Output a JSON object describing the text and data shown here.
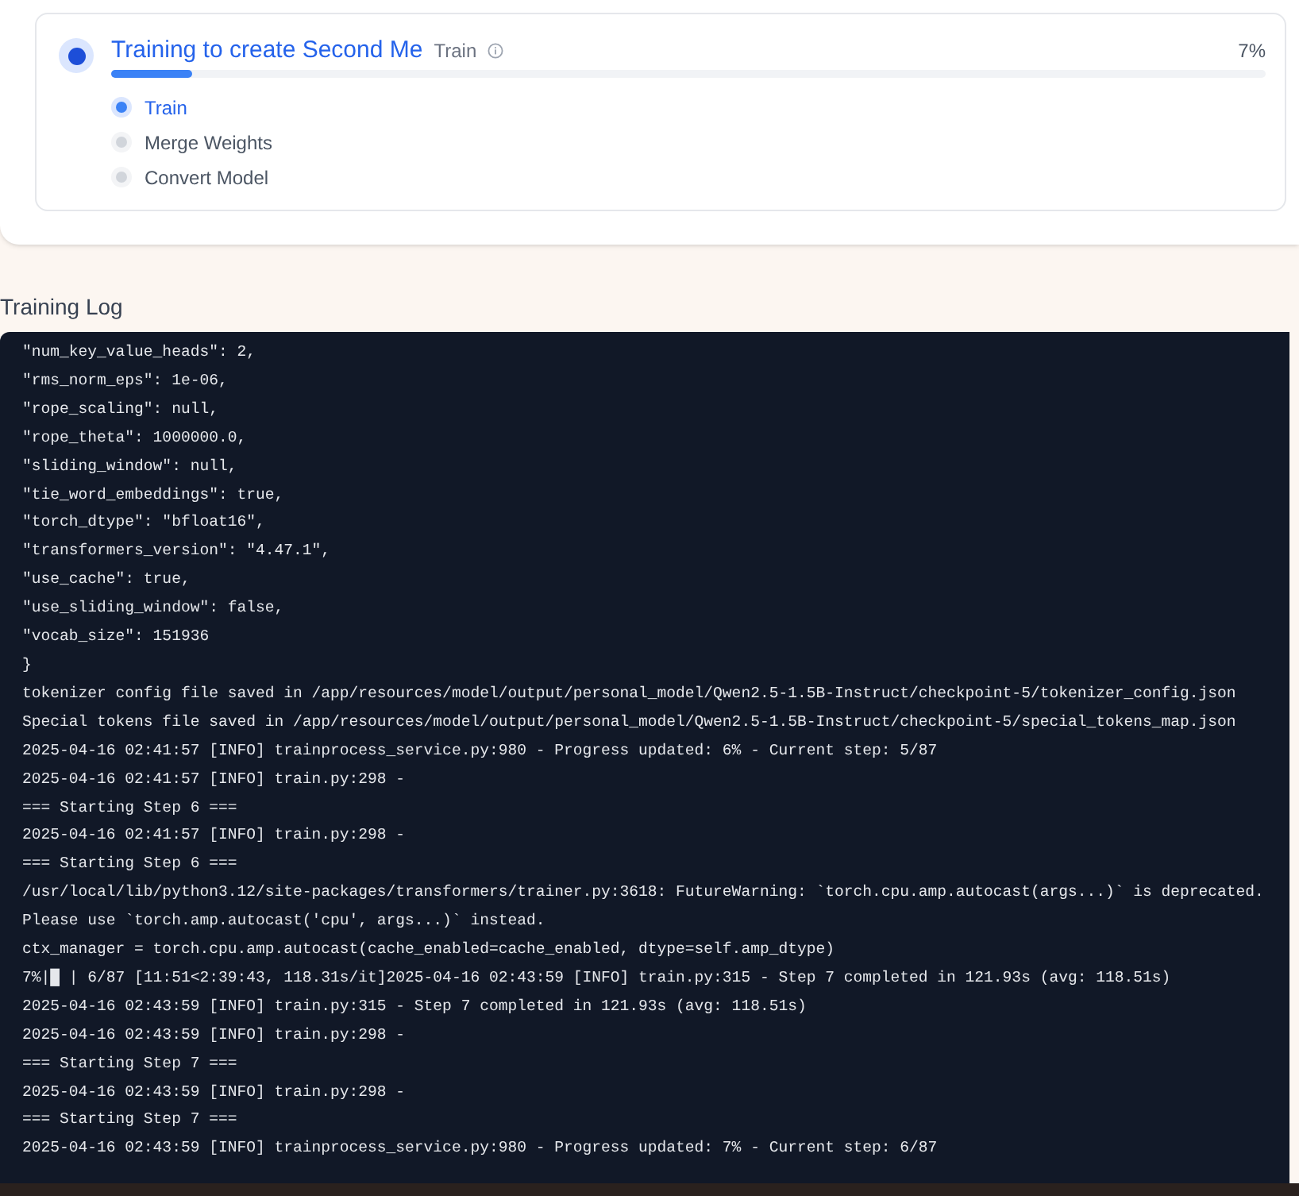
{
  "stage": {
    "title": "Training to create Second Me",
    "tag": "Train",
    "percent": "7%",
    "level": 0.07,
    "steps": [
      {
        "label": "Train",
        "selected": true
      },
      {
        "label": "Merge Weights",
        "selected": false
      },
      {
        "label": "Convert Model",
        "selected": false
      }
    ]
  },
  "log": {
    "title": "Training Log",
    "lines": [
      "\"num_key_value_heads\": 2,",
      "\"rms_norm_eps\": 1e-06,",
      "\"rope_scaling\": null,",
      "\"rope_theta\": 1000000.0,",
      "\"sliding_window\": null,",
      "\"tie_word_embeddings\": true,",
      "\"torch_dtype\": \"bfloat16\",",
      "\"transformers_version\": \"4.47.1\",",
      "\"use_cache\": true,",
      "\"use_sliding_window\": false,",
      "\"vocab_size\": 151936",
      "}",
      "tokenizer config file saved in /app/resources/model/output/personal_model/Qwen2.5-1.5B-Instruct/checkpoint-5/tokenizer_config.json",
      "Special tokens file saved in /app/resources/model/output/personal_model/Qwen2.5-1.5B-Instruct/checkpoint-5/special_tokens_map.json",
      "2025-04-16 02:41:57 [INFO] trainprocess_service.py:980 - Progress updated: 6% - Current step: 5/87",
      "2025-04-16 02:41:57 [INFO] train.py:298 -",
      "=== Starting Step 6 ===",
      "2025-04-16 02:41:57 [INFO] train.py:298 -",
      "=== Starting Step 6 ===",
      "/usr/local/lib/python3.12/site-packages/transformers/trainer.py:3618: FutureWarning: `torch.cpu.amp.autocast(args...)` is deprecated.",
      "Please use `torch.amp.autocast('cpu', args...)` instead.",
      "ctx_manager = torch.cpu.amp.autocast(cache_enabled=cache_enabled, dtype=self.amp_dtype)",
      "7%|█ | 6/87 [11:51<2:39:43, 118.31s/it]2025-04-16 02:43:59 [INFO] train.py:315 - Step 7 completed in 121.93s (avg: 118.51s)",
      "2025-04-16 02:43:59 [INFO] train.py:315 - Step 7 completed in 121.93s (avg: 118.51s)",
      "2025-04-16 02:43:59 [INFO] train.py:298 -",
      "=== Starting Step 7 ===",
      "2025-04-16 02:43:59 [INFO] train.py:298 -",
      "=== Starting Step 7 ===",
      "2025-04-16 02:43:59 [INFO] trainprocess_service.py:980 - Progress updated: 7% - Current step: 6/87"
    ]
  }
}
